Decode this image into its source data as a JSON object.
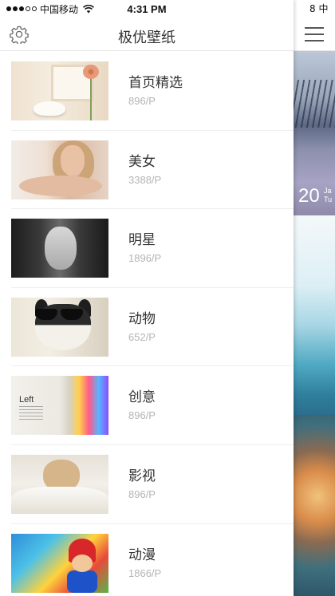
{
  "status_bar": {
    "carrier": "中国移动",
    "time": "4:31 PM",
    "peek_text": "8"
  },
  "navbar": {
    "title": "极优壁纸",
    "settings_icon": "gear-icon"
  },
  "categories": [
    {
      "title": "首页精选",
      "count": "896/P"
    },
    {
      "title": "美女",
      "count": "3388/P"
    },
    {
      "title": "明星",
      "count": "1896/P"
    },
    {
      "title": "动物",
      "count": "652/P"
    },
    {
      "title": "创意",
      "count": "896/P"
    },
    {
      "title": "影视",
      "count": "896/P"
    },
    {
      "title": "动漫",
      "count": "1866/P"
    }
  ],
  "thumb_text": {
    "creative_word": "Left"
  },
  "peek_panel": {
    "menu_icon": "hamburger-icon",
    "date_day": "20",
    "date_line1": "Ja",
    "date_line2": "Tu"
  },
  "colors": {
    "title_text": "#333333",
    "count_text": "#b4b4b4",
    "divider": "#eeeeee"
  }
}
